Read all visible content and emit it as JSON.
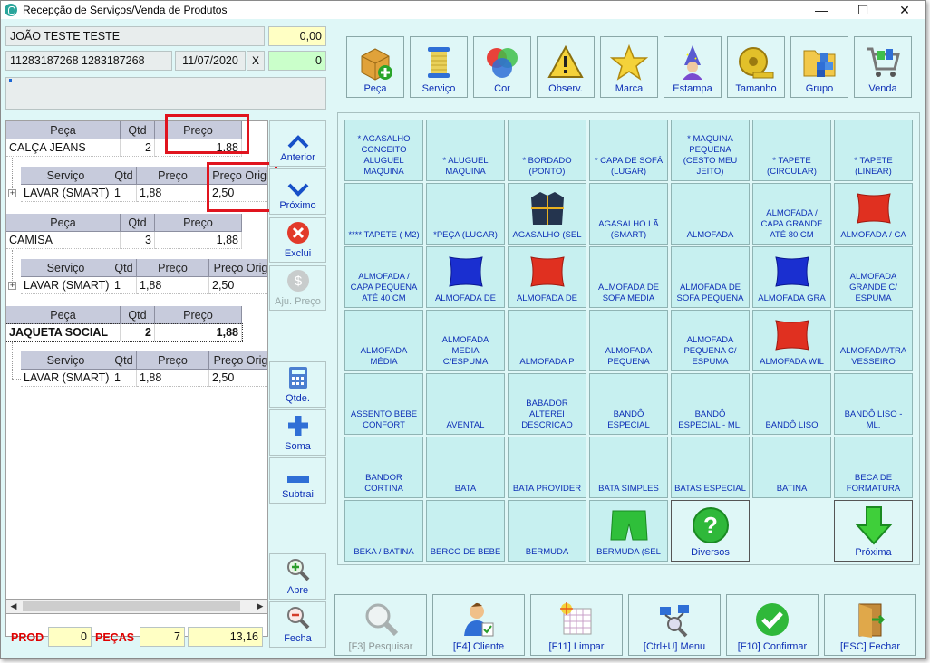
{
  "window": {
    "title": "Recepção de Serviços/Venda de Produtos",
    "minimize": "—",
    "maximize": "☐",
    "close": "✕"
  },
  "client": {
    "name": "JOÃO TESTE TESTE",
    "balance": "0,00",
    "phones": "11283187268 1283187268",
    "date": "11/07/2020",
    "date_clear": "X",
    "counter": "0"
  },
  "grid": {
    "items": [
      {
        "header": {
          "peca": "Peça",
          "qtd": "Qtd",
          "preco": "Preço"
        },
        "peca": "CALÇA JEANS",
        "qtd": "2",
        "preco": "1,88",
        "sub_header": {
          "servico": "Serviço",
          "qtd": "Qtd",
          "preco": "Preço",
          "preco_orig": "Preço Origi"
        },
        "servico": "LAVAR (SMART)",
        "s_qtd": "1",
        "s_preco": "1,88",
        "s_preco_orig": "2,50"
      },
      {
        "header": {
          "peca": "Peça",
          "qtd": "Qtd",
          "preco": "Preço"
        },
        "peca": "CAMISA",
        "qtd": "3",
        "preco": "1,88",
        "sub_header": {
          "servico": "Serviço",
          "qtd": "Qtd",
          "preco": "Preço",
          "preco_orig": "Preço Orig"
        },
        "servico": "LAVAR (SMART)",
        "s_qtd": "1",
        "s_preco": "1,88",
        "s_preco_orig": "2,50"
      },
      {
        "header": {
          "peca": "Peça",
          "qtd": "Qtd",
          "preco": "Preço"
        },
        "peca": "JAQUETA SOCIAL",
        "qtd": "2",
        "preco": "1,88",
        "sub_header": {
          "servico": "Serviço",
          "qtd": "Qtd",
          "preco": "Preço",
          "preco_orig": "Preço Orig"
        },
        "servico": "LAVAR (SMART)",
        "s_qtd": "1",
        "s_preco": "1,88",
        "s_preco_orig": "2,50"
      }
    ]
  },
  "side_buttons": {
    "anterior": "Anterior",
    "proximo": "Próximo",
    "exclui": "Exclui",
    "aju_preco": "Aju. Preço",
    "qtde": "Qtde.",
    "soma": "Soma",
    "subtrai": "Subtrai",
    "abre": "Abre",
    "fecha": "Fecha"
  },
  "totals": {
    "prod_label": "PROD",
    "prod": "0",
    "pecas_label": "PEÇAS",
    "pecas": "7",
    "total": "13,16"
  },
  "categories": [
    "Peça",
    "Serviço",
    "Cor",
    "Observ.",
    "Marca",
    "Estampa",
    "Tamanho",
    "Grupo",
    "Venda"
  ],
  "products": [
    "* AGASALHO CONCEITO ALUGUEL MAQUINA",
    "* ALUGUEL MAQUINA",
    "* BORDADO (PONTO)",
    "* CAPA DE SOFÁ (LUGAR)",
    "* MAQUINA PEQUENA (CESTO MEU JEITO)",
    "* TAPETE (CIRCULAR)",
    "* TAPETE (LINEAR)",
    "**** TAPETE ( M2)",
    "*PEÇA (LUGAR)",
    "AGASALHO (SEL",
    "AGASALHO LÃ (SMART)",
    "ALMOFADA",
    "ALMOFADA / CAPA GRANDE ATÉ 80 CM",
    "ALMOFADA / CA",
    "ALMOFADA / CAPA PEQUENA ATÉ 40 CM",
    "ALMOFADA DE",
    "ALMOFADA DE",
    "ALMOFADA DE SOFA MEDIA",
    "ALMOFADA DE SOFA PEQUENA",
    "ALMOFADA GRA",
    "ALMOFADA GRANDE C/ ESPUMA",
    "ALMOFADA MÉDIA",
    "ALMOFADA MEDIA C/ESPUMA",
    "ALMOFADA P",
    "ALMOFADA PEQUENA",
    "ALMOFADA PEQUENA C/ ESPUMA",
    "ALMOFADA WIL",
    "ALMOFADA/TRA VESSEIRO",
    "ASSENTO BEBE CONFORT",
    "AVENTAL",
    "BABADOR ALTEREI DESCRICAO",
    "BANDÔ ESPECIAL",
    "BANDÔ ESPECIAL - ML.",
    "BANDÔ LISO",
    "BANDÔ LISO - ML.",
    "BANDOR CORTINA",
    "BATA",
    "BATA PROVIDER",
    "BATA SIMPLES",
    "BATAS ESPECIAL",
    "BATINA",
    "BECA DE FORMATURA",
    "BEKA / BATINA",
    "BERCO DE BEBE",
    "BERMUDA",
    "BERMUDA (SEL",
    "Diversos",
    "",
    "Próxima"
  ],
  "footer": [
    "[F3] Pesquisar",
    "[F4] Cliente",
    "[F11] Limpar",
    "[Ctrl+U] Menu",
    "[F10] Confirmar",
    "[ESC] Fechar"
  ],
  "colors": {
    "bg": "#dff7f7",
    "accent_text": "#0d2fb6",
    "highlight": "#e0141e",
    "yellow_field": "#ffffc4",
    "green_field": "#caffca"
  }
}
